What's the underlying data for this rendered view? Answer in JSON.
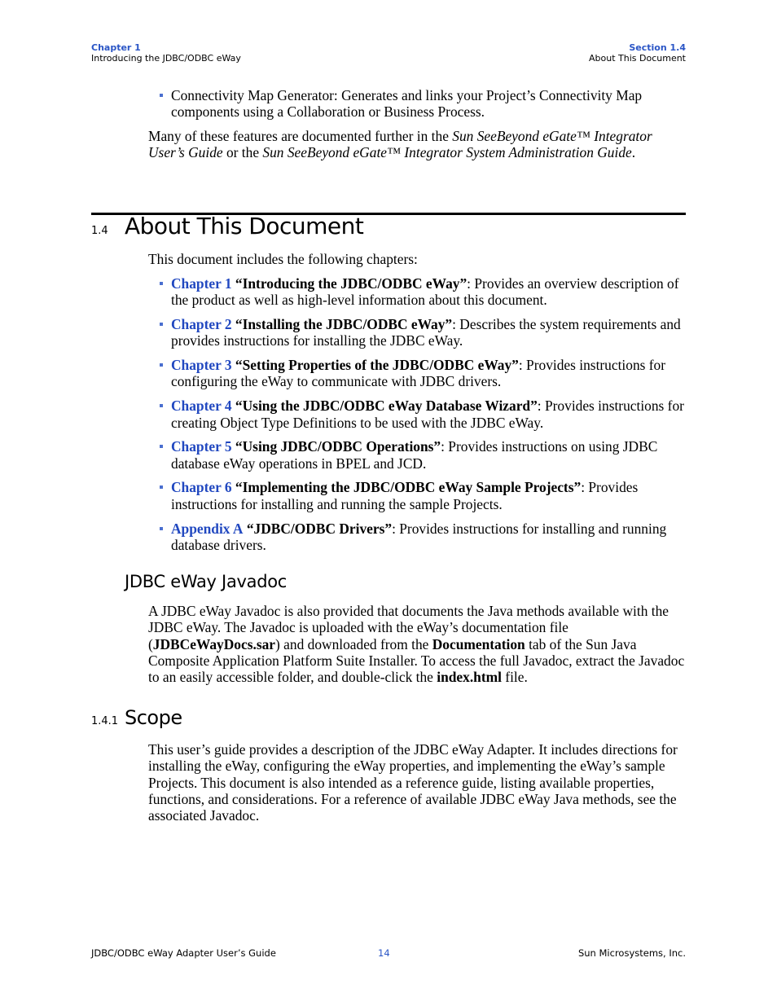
{
  "header": {
    "chapter_label": "Chapter 1",
    "chapter_title": "Introducing the JDBC/ODBC eWay",
    "section_label": "Section 1.4",
    "section_title": "About This Document"
  },
  "intro": {
    "bullet": "Connectivity Map Generator: Generates and links your Project’s Connectivity Map components using a Collaboration or Business Process.",
    "para_prefix": "Many of these features are documented further in the ",
    "para_ref1": "Sun SeeBeyond eGate™ Integrator User’s Guide",
    "para_mid": " or the ",
    "para_ref2": "Sun SeeBeyond eGate™ Integrator System Administration Guide",
    "para_suffix": "."
  },
  "section": {
    "number": "1.4",
    "title": "About This Document",
    "lead": "This document includes the following chapters:",
    "chapters": [
      {
        "link": "Chapter 1",
        "title": "“Introducing the JDBC/ODBC eWay”",
        "desc": ": Provides an overview description of the product as well as high-level information about this document."
      },
      {
        "link": "Chapter 2",
        "title": "“Installing the JDBC/ODBC eWay”",
        "desc": ": Describes the system requirements and provides instructions for installing the JDBC eWay."
      },
      {
        "link": "Chapter 3",
        "title": "“Setting Properties of the JDBC/ODBC eWay”",
        "desc": ": Provides instructions for configuring the eWay to communicate with JDBC drivers."
      },
      {
        "link": "Chapter 4",
        "title": "“Using the JDBC/ODBC eWay Database Wizard”",
        "desc": ": Provides instructions for creating Object Type Definitions to be used with the JDBC eWay."
      },
      {
        "link": "Chapter 5",
        "title": "“Using JDBC/ODBC Operations”",
        "desc": ": Provides instructions on using JDBC database eWay operations in BPEL and JCD."
      },
      {
        "link": "Chapter 6",
        "title": "“Implementing the JDBC/ODBC eWay Sample Projects”",
        "desc": ": Provides instructions for installing and running the sample Projects."
      },
      {
        "link": "Appendix A",
        "title": "“JDBC/ODBC Drivers”",
        "desc": ": Provides instructions for installing and running database drivers."
      }
    ]
  },
  "javadoc": {
    "title": "JDBC eWay Javadoc",
    "p1": "A JDBC eWay Javadoc is also provided that documents the Java methods available with the JDBC eWay. The Javadoc is uploaded with the eWay’s documentation file (",
    "b1": "JDBCeWayDocs.sar",
    "p2": ") and downloaded from the ",
    "b2": "Documentation",
    "p3": " tab of the Sun Java Composite Application Platform Suite Installer. To access the full Javadoc, extract the Javadoc to an easily accessible folder, and double-click the ",
    "b3": "index.html",
    "p4": " file."
  },
  "scope": {
    "number": "1.4.1",
    "title": "Scope",
    "text": "This user’s guide provides a description of the JDBC eWay Adapter. It includes directions for installing the eWay, configuring the eWay properties, and implementing the eWay’s sample Projects. This document is also intended as a reference guide, listing available properties, functions, and considerations. For a reference of available JDBC eWay Java methods, see the associated Javadoc."
  },
  "footer": {
    "left": "JDBC/ODBC eWay Adapter User’s Guide",
    "page": "14",
    "right": "Sun Microsystems, Inc."
  }
}
